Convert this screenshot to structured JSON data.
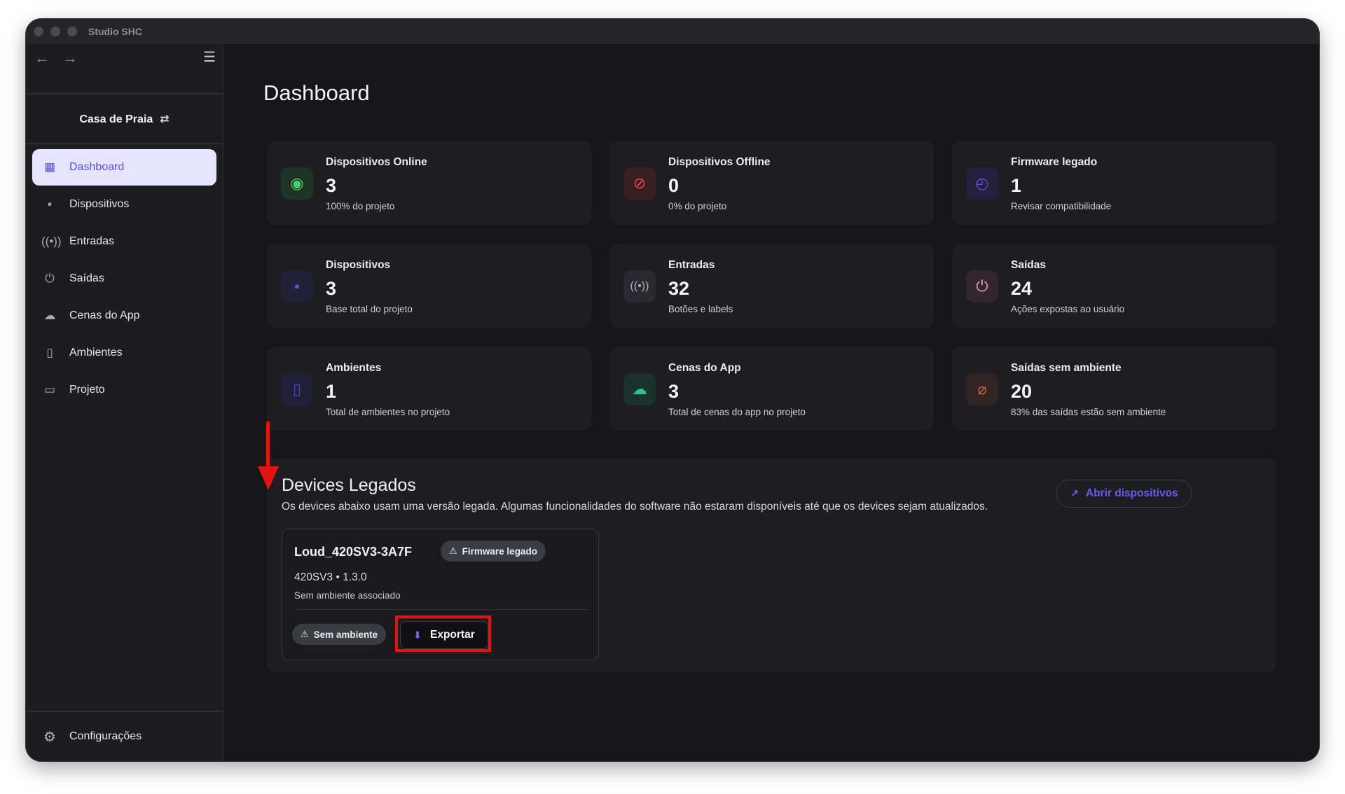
{
  "window": {
    "title": "Studio SHC"
  },
  "sidebar": {
    "nav_back_icon": "arrow-left-icon",
    "nav_forward_icon": "arrow-right-icon",
    "collapse_icon": "sidebar-collapse-icon",
    "project": {
      "name": "Casa de Praia",
      "switch_icon": "swap-icon"
    },
    "items": [
      {
        "label": "Dashboard",
        "icon": "dashboard-icon",
        "active": true
      },
      {
        "label": "Dispositivos",
        "icon": "grid-icon",
        "active": false
      },
      {
        "label": "Entradas",
        "icon": "broadcast-icon",
        "active": false
      },
      {
        "label": "Saídas",
        "icon": "plug-icon",
        "active": false
      },
      {
        "label": "Cenas do App",
        "icon": "cloud-icon",
        "active": false
      },
      {
        "label": "Ambientes",
        "icon": "door-icon",
        "active": false
      },
      {
        "label": "Projeto",
        "icon": "folder-icon",
        "active": false
      }
    ],
    "settings": {
      "label": "Configurações",
      "icon": "gear-icon"
    }
  },
  "main": {
    "title": "Dashboard",
    "stats": [
      {
        "label": "Dispositivos Online",
        "value": "3",
        "sub": "100% do projeto",
        "icon": "signal-icon",
        "color": "#4ccf6a"
      },
      {
        "label": "Dispositivos Offline",
        "value": "0",
        "sub": "0% do projeto",
        "icon": "signal-off-icon",
        "color": "#e5484d"
      },
      {
        "label": "Firmware legado",
        "value": "1",
        "sub": "Revisar compatibilidade",
        "icon": "history-icon",
        "color": "#6b4fe0"
      },
      {
        "label": "Dispositivos",
        "value": "3",
        "sub": "Base total do projeto",
        "icon": "grid-icon",
        "color": "#5b4de6"
      },
      {
        "label": "Entradas",
        "value": "32",
        "sub": "Botões e labels",
        "icon": "broadcast-icon",
        "color": "#b0b0b8"
      },
      {
        "label": "Saídas",
        "value": "24",
        "sub": "Ações expostas ao usuário",
        "icon": "plug-icon",
        "color": "#e39ac0"
      },
      {
        "label": "Ambientes",
        "value": "1",
        "sub": "Total de ambientes no projeto",
        "icon": "door-icon",
        "color": "#4b3fc6"
      },
      {
        "label": "Cenas do App",
        "value": "3",
        "sub": "Total de cenas do app no projeto",
        "icon": "cloud-icon",
        "color": "#2fbf9a"
      },
      {
        "label": "Saídas sem ambiente",
        "value": "20",
        "sub": "83% das saídas estão sem ambiente",
        "icon": "location-off-icon",
        "color": "#c9624b"
      }
    ],
    "legacy": {
      "title": "Devices Legados",
      "description": "Os devices abaixo usam uma versão legada. Algumas funcionalidades do software não estaram disponíveis até que os devices sejam atualizados.",
      "open_button": "Abrir dispositivos",
      "device": {
        "name": "Loud_420SV3-3A7F",
        "badge": "Firmware legado",
        "model": "420SV3 • 1.3.0",
        "environment": "Sem ambiente associado",
        "env_badge": "Sem ambiente",
        "export_button": "Exportar"
      }
    }
  },
  "colors": {
    "accent": "#5b4de6",
    "annotation": "#e3140f"
  }
}
